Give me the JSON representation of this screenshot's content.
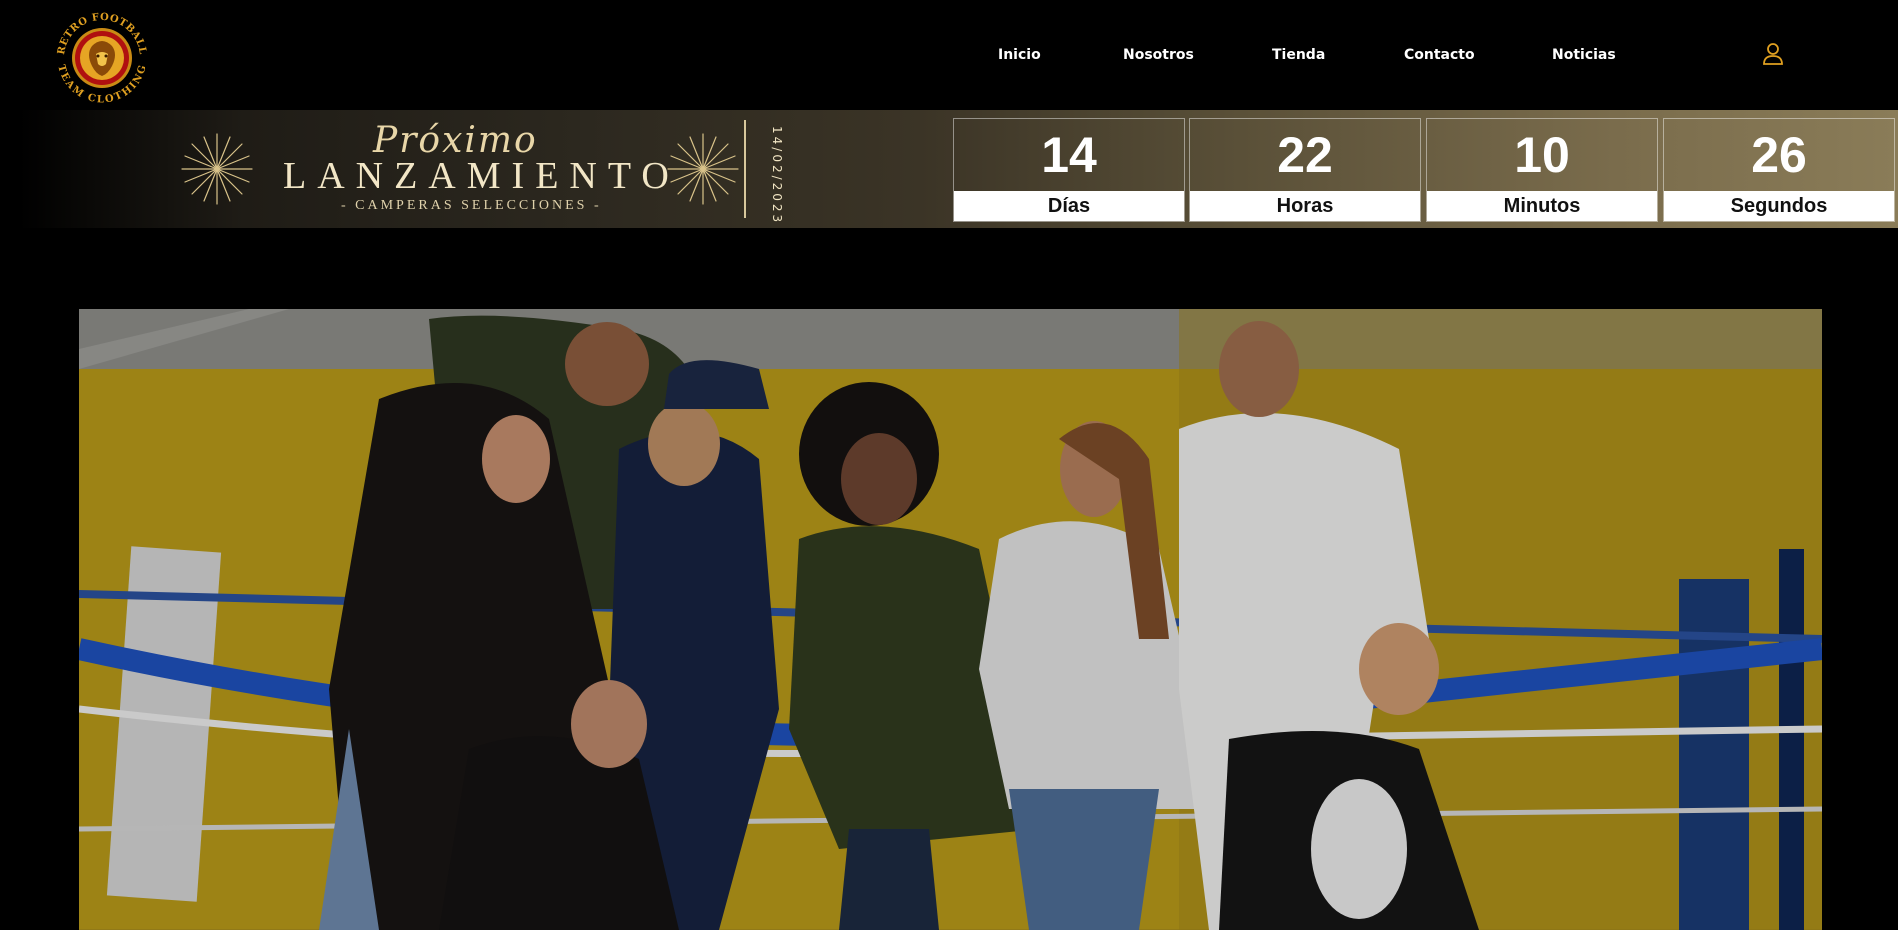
{
  "brand": {
    "logo_text": "RETRO FOOTBALL TEAM CLOTHING",
    "logo_top": "RETRO FOOTBALL",
    "logo_bottom": "TEAM CLOTHING",
    "accent": "#e0a021"
  },
  "nav": {
    "items": [
      {
        "label": "Inicio"
      },
      {
        "label": "Nosotros"
      },
      {
        "label": "Tienda"
      },
      {
        "label": "Contacto"
      },
      {
        "label": "Noticias"
      }
    ],
    "user_icon": "user-icon"
  },
  "banner": {
    "script_title": "Próximo",
    "title": "LANZAMIENTO",
    "subtitle": "- CAMPERAS SELECCIONES -",
    "date": "14/02/2023",
    "countdown": [
      {
        "value": "14",
        "label": "Días"
      },
      {
        "value": "22",
        "label": "Horas"
      },
      {
        "value": "10",
        "label": "Minutos"
      },
      {
        "value": "26",
        "label": "Segundos"
      }
    ]
  },
  "hero": {
    "image": "group-of-models-in-boxing-ring"
  }
}
